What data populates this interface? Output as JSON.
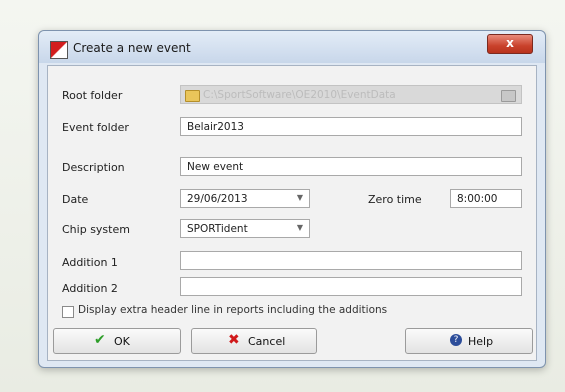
{
  "dialog": {
    "title": "Create a new event",
    "close_label": "x"
  },
  "form": {
    "root_folder": {
      "label": "Root folder",
      "value": "C:\\SportSoftware\\OE2010\\EventData"
    },
    "event_folder": {
      "label": "Event folder",
      "value": "Belair2013"
    },
    "description": {
      "label": "Description",
      "value": "New event"
    },
    "date": {
      "label": "Date",
      "value": "29/06/2013"
    },
    "zero_time": {
      "label": "Zero time",
      "value": "8:00:00"
    },
    "chip_system": {
      "label": "Chip system",
      "value": "SPORTident"
    },
    "addition1": {
      "label": "Addition 1",
      "value": ""
    },
    "addition2": {
      "label": "Addition 2",
      "value": ""
    },
    "extra_header": {
      "label": "Display extra header line in reports including the additions",
      "checked": false
    }
  },
  "buttons": {
    "ok": "OK",
    "cancel": "Cancel",
    "help": "Help"
  },
  "colors": {
    "ok_check": "#2e9e2a",
    "cancel_x": "#d0191b",
    "help_icon": "#2c4d9a"
  }
}
